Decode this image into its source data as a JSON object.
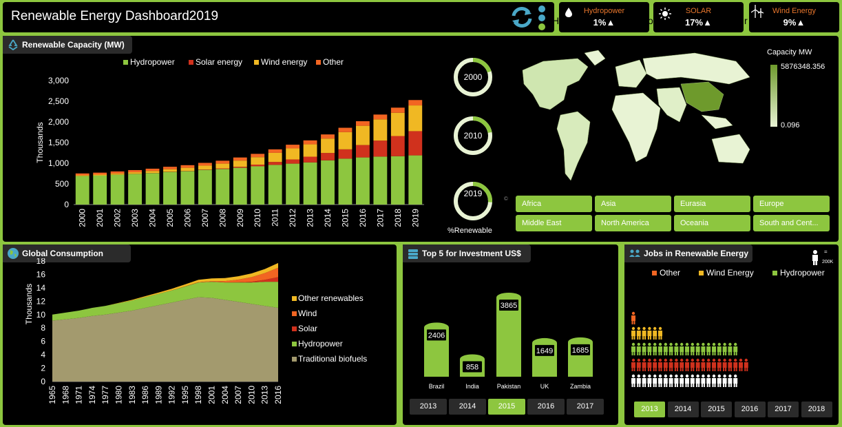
{
  "header": {
    "title": "Renewable Energy Dashboard2019",
    "sidebar_hint": "H",
    "sidebar_hint2": "o",
    "sidebar_hint3": "r"
  },
  "kpis": [
    {
      "label": "Hydropower",
      "value": "1%▲",
      "icon": "water-drop-icon"
    },
    {
      "label": "SOLAR",
      "value": "17%▲",
      "icon": "sun-icon"
    },
    {
      "label": "Wind Energy",
      "value": "9%▲",
      "icon": "wind-turbine-icon"
    }
  ],
  "colors": {
    "hydro": "#8dc63f",
    "solar": "#d0311d",
    "wind": "#f0b823",
    "other": "#f26522",
    "biofuel": "#a39a6e",
    "map_dark": "#6e9a2c",
    "map_light": "#e8f3d4"
  },
  "capacity": {
    "title": "Renewable Capacity (MW)",
    "chart_data": {
      "type": "bar",
      "stacked": true,
      "ylabel": "Thousands",
      "ylim": [
        0,
        3000
      ],
      "yticks": [
        "0",
        "500",
        "1,000",
        "1,500",
        "2,000",
        "2,500",
        "3,000"
      ],
      "categories": [
        "2000",
        "2001",
        "2002",
        "2003",
        "2004",
        "2005",
        "2006",
        "2007",
        "2008",
        "2009",
        "2010",
        "2011",
        "2012",
        "2013",
        "2014",
        "2015",
        "2016",
        "2017",
        "2018",
        "2019"
      ],
      "legend_position": "top",
      "series": [
        {
          "name": "Hydropower",
          "color": "#8dc63f",
          "values": [
            690,
            700,
            720,
            740,
            760,
            790,
            810,
            840,
            860,
            890,
            925,
            960,
            990,
            1020,
            1070,
            1110,
            1140,
            1160,
            1170,
            1190
          ]
        },
        {
          "name": "Solar energy",
          "color": "#d0311d",
          "values": [
            1,
            1,
            2,
            3,
            4,
            5,
            6,
            9,
            15,
            23,
            41,
            71,
            101,
            138,
            178,
            226,
            300,
            388,
            488,
            586
          ]
        },
        {
          "name": "Wind energy",
          "color": "#f0b823",
          "values": [
            17,
            24,
            31,
            39,
            48,
            59,
            74,
            94,
            115,
            151,
            181,
            220,
            267,
            299,
            349,
            416,
            466,
            514,
            563,
            623
          ]
        },
        {
          "name": "Other",
          "color": "#f26522",
          "values": [
            45,
            47,
            49,
            52,
            56,
            60,
            63,
            66,
            71,
            75,
            80,
            85,
            90,
            96,
            100,
            106,
            111,
            116,
            124,
            130
          ]
        }
      ]
    }
  },
  "donuts": {
    "years": [
      "2000",
      "2010",
      "2019"
    ],
    "fractions": [
      0.2,
      0.22,
      0.26
    ],
    "label": "%Renewable"
  },
  "map": {
    "legend_title": "Capacity MW",
    "legend_max": "5876348.356",
    "legend_min": "0.096",
    "copyright": "©"
  },
  "regions": [
    "Africa",
    "Asia",
    "Eurasia",
    "Europe",
    "Middle East",
    "North America",
    "Oceania",
    "South and Cent..."
  ],
  "consumption": {
    "title": "Global Consumption",
    "chart_data": {
      "type": "area",
      "stacked": true,
      "ylabel": "Thousands",
      "ylim": [
        0,
        18
      ],
      "yticks": [
        "0",
        "2",
        "4",
        "6",
        "8",
        "10",
        "12",
        "14",
        "16",
        "18"
      ],
      "x": [
        "1965",
        "1968",
        "1971",
        "1974",
        "1977",
        "1980",
        "1983",
        "1986",
        "1989",
        "1992",
        "1995",
        "1998",
        "2001",
        "2004",
        "2007",
        "2010",
        "2013",
        "2016"
      ],
      "legend_position": "right",
      "series": [
        {
          "name": "Traditional biofuels",
          "color": "#a39a6e",
          "values": [
            9.1,
            9.3,
            9.5,
            9.8,
            10.0,
            10.3,
            10.6,
            11.0,
            11.4,
            11.8,
            12.2,
            12.6,
            12.5,
            12.2,
            11.9,
            11.6,
            11.3,
            11.0
          ]
        },
        {
          "name": "Hydropower",
          "color": "#8dc63f",
          "values": [
            0.9,
            1.0,
            1.1,
            1.2,
            1.3,
            1.4,
            1.5,
            1.6,
            1.7,
            1.8,
            2.0,
            2.2,
            2.4,
            2.6,
            2.9,
            3.2,
            3.6,
            3.9
          ]
        },
        {
          "name": "Solar",
          "color": "#d0311d",
          "values": [
            0,
            0,
            0,
            0,
            0,
            0,
            0,
            0,
            0,
            0,
            0,
            0,
            0,
            0.01,
            0.02,
            0.1,
            0.3,
            0.7
          ]
        },
        {
          "name": "Wind",
          "color": "#f26522",
          "values": [
            0,
            0,
            0,
            0,
            0,
            0,
            0,
            0,
            0,
            0.01,
            0.02,
            0.05,
            0.1,
            0.2,
            0.4,
            0.7,
            1.0,
            1.4
          ]
        },
        {
          "name": "Other renewables",
          "color": "#f0b823",
          "values": [
            0,
            0,
            0,
            0,
            0,
            0.05,
            0.1,
            0.15,
            0.2,
            0.25,
            0.3,
            0.35,
            0.4,
            0.45,
            0.5,
            0.55,
            0.6,
            0.7
          ]
        }
      ]
    }
  },
  "investment": {
    "title": "Top 5 for Investment US$",
    "chart_data": {
      "type": "bar",
      "categories": [
        "Brazil",
        "India",
        "Pakistan",
        "UK",
        "Zambia"
      ],
      "values": [
        2406,
        858,
        3865,
        1649,
        1685
      ],
      "ylim": [
        0,
        4200
      ]
    },
    "years": [
      "2013",
      "2014",
      "2015",
      "2016",
      "2017"
    ],
    "selected_year": "2015"
  },
  "jobs": {
    "title": "Jobs in Renewable Energy",
    "unit_label": "=",
    "unit_value": "200K",
    "legend": [
      {
        "name": "Other",
        "color": "#f26522"
      },
      {
        "name": "Wind Energy",
        "color": "#f0b823"
      },
      {
        "name": "Hydropower",
        "color": "#8dc63f"
      }
    ],
    "rows": [
      {
        "color": "#f26522",
        "count": 1
      },
      {
        "color": "#f0b823",
        "count": 6
      },
      {
        "color": "#8dc63f",
        "count": 20
      },
      {
        "color": "#d0311d",
        "count": 22
      },
      {
        "color": "#ffffff",
        "count": 20
      }
    ],
    "years": [
      "2013",
      "2014",
      "2015",
      "2016",
      "2017",
      "2018"
    ],
    "selected_year": "2013"
  }
}
